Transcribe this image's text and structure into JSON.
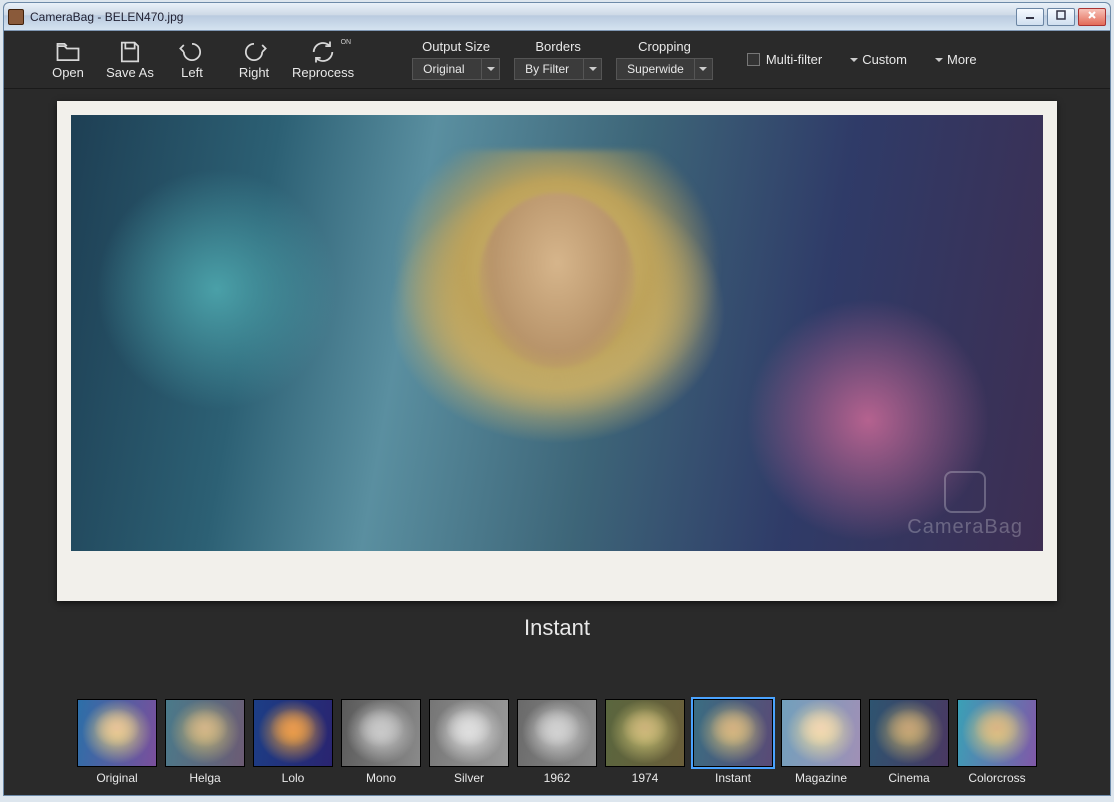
{
  "window": {
    "title": "CameraBag - BELEN470.jpg"
  },
  "toolbar": {
    "open": "Open",
    "save_as": "Save As",
    "left": "Left",
    "right": "Right",
    "reprocess": "Reprocess",
    "reprocess_toggle": "ON",
    "output_size_label": "Output Size",
    "output_size_value": "Original",
    "borders_label": "Borders",
    "borders_value": "By Filter",
    "cropping_label": "Cropping",
    "cropping_value": "Superwide",
    "multi_filter": "Multi-filter",
    "custom": "Custom",
    "more": "More"
  },
  "watermark": "CameraBag",
  "current_filter": "Instant",
  "filters": [
    {
      "id": "original",
      "label": "Original",
      "cls": "f-original"
    },
    {
      "id": "helga",
      "label": "Helga",
      "cls": "f-helga"
    },
    {
      "id": "lolo",
      "label": "Lolo",
      "cls": "f-lolo"
    },
    {
      "id": "mono",
      "label": "Mono",
      "cls": "f-mono"
    },
    {
      "id": "silver",
      "label": "Silver",
      "cls": "f-silver"
    },
    {
      "id": "1962",
      "label": "1962",
      "cls": "f-1962"
    },
    {
      "id": "1974",
      "label": "1974",
      "cls": "f-1974"
    },
    {
      "id": "instant",
      "label": "Instant",
      "cls": "f-instant",
      "selected": true
    },
    {
      "id": "magazine",
      "label": "Magazine",
      "cls": "f-magazine"
    },
    {
      "id": "cinema",
      "label": "Cinema",
      "cls": "f-cinema"
    },
    {
      "id": "colorcross",
      "label": "Colorcross",
      "cls": "f-colorcross"
    }
  ]
}
